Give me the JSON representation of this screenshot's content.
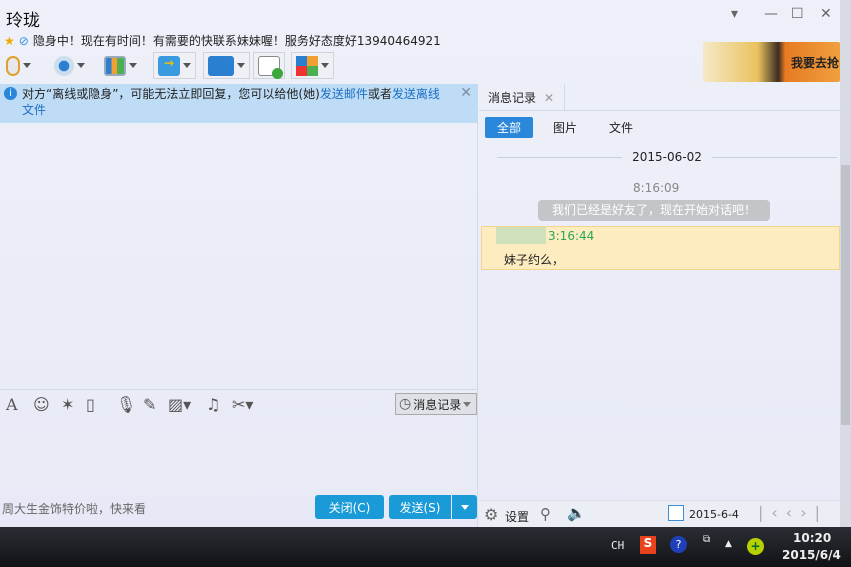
{
  "window": {
    "title": "玲珑",
    "signature": "隐身中！现在有时间！有需要的快联系妹妹喔！服务好态度好13940464921",
    "ad_text": "我要去抢"
  },
  "toolbar": {
    "icons": [
      "microphone-icon",
      "camera-icon",
      "screen-share-icon",
      "send-file-icon",
      "remote-desktop-icon",
      "add-chat-icon",
      "apps-icon"
    ]
  },
  "notice": {
    "text": "对方“离线或隐身”，可能无法立即回复，您可以给他(她)",
    "link1": "发送邮件",
    "or": "或者",
    "link2": "发送离线文件"
  },
  "input_toolbar": {
    "history_label": "消息记录"
  },
  "bottom": {
    "ad_text": "周大生金饰特价啦，快来看",
    "close_label": "关闭(C)",
    "send_label": "发送(S)"
  },
  "history": {
    "tab_label": "消息记录",
    "filters": [
      "全部",
      "图片",
      "文件"
    ],
    "active_filter": "全部",
    "date": "2015-06-02",
    "system_time": "8:16:09",
    "system_message": "我们已经是好友了，现在开始对话吧！",
    "message_time": "3:16:44",
    "message_text": "妹子约么，",
    "settings_label": "设置",
    "calendar_date": "2015-6-4"
  },
  "taskbar": {
    "lang": "CH",
    "time": "10:20",
    "date": "2015/6/4"
  },
  "colors": {
    "accent": "#1a9bd7",
    "notice_bg": "#bedcf5",
    "message_bg": "#fdecc0",
    "filter_active": "#2b87da",
    "time_green": "#2aa85a"
  }
}
